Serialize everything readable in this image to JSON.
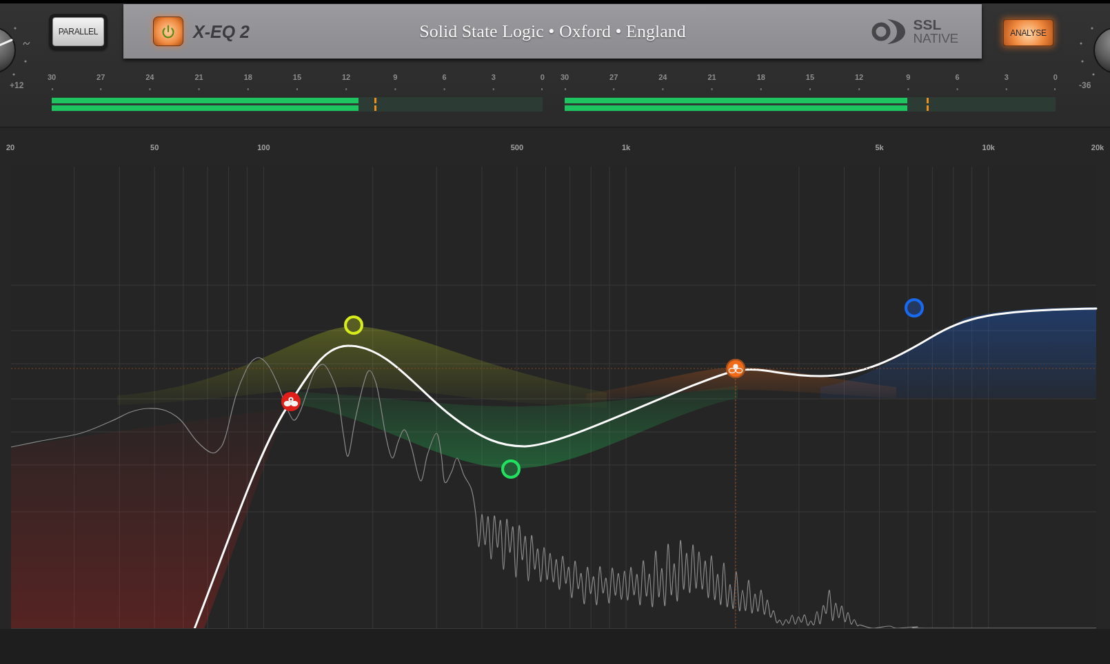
{
  "input_knob": {
    "label": "+12"
  },
  "parallel_button": {
    "label": "PARALLEL",
    "on": false
  },
  "header_plate": {
    "power_button": {
      "on": true
    },
    "product_name": "X-EQ 2",
    "title": "Solid State Logic • Oxford • England",
    "brand": {
      "name": "SSL",
      "subtitle": "NATIVE"
    }
  },
  "analyse_button": {
    "label": "ANALYSE",
    "on": true
  },
  "output_knob": {
    "label": "-36"
  },
  "meters": [
    {
      "scale": [
        "30",
        "27",
        "24",
        "21",
        "18",
        "15",
        "12",
        "9",
        "6",
        "3",
        "0"
      ],
      "channels": [
        {
          "level": 0.625
        },
        {
          "level": 0.625
        }
      ],
      "peak": {
        "level": 0.66
      }
    },
    {
      "scale": [
        "30",
        "27",
        "24",
        "21",
        "18",
        "15",
        "12",
        "9",
        "6",
        "3",
        "0"
      ],
      "channels": [
        {
          "level": 0.698
        },
        {
          "level": 0.698
        }
      ],
      "peak": {
        "level": 0.739
      }
    }
  ],
  "eq_graph": {
    "frequency_labels": [
      "20",
      "50",
      "100",
      "500",
      "1k",
      "5k",
      "10k",
      "20k"
    ],
    "bands": [
      {
        "kind": "solid",
        "color": "#e01f1b",
        "selected": false
      },
      {
        "kind": "ring",
        "color": "#d6ec1c",
        "selected": false
      },
      {
        "kind": "ring",
        "color": "#22e060",
        "selected": false
      },
      {
        "kind": "solid",
        "color": "#f06a18",
        "selected": true
      },
      {
        "kind": "ring",
        "color": "#1a6af0",
        "selected": false
      }
    ]
  }
}
